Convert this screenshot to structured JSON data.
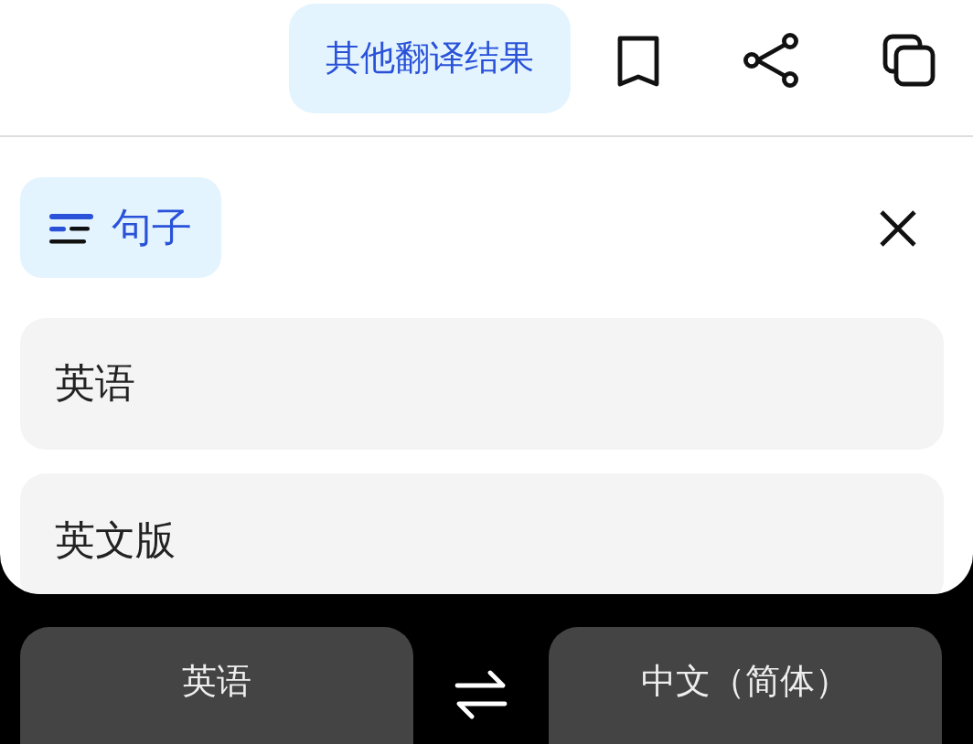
{
  "header": {
    "other_results_button": "其他翻译结果"
  },
  "filter_chip": {
    "label": "句子"
  },
  "results": [
    {
      "text": "英语"
    },
    {
      "text": "英文版"
    }
  ],
  "language_bar": {
    "source": "英语",
    "target": "中文（简体）"
  }
}
